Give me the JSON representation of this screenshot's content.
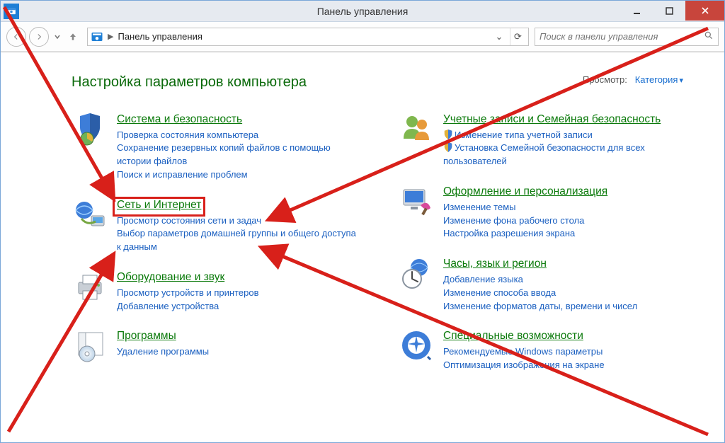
{
  "window": {
    "title": "Панель управления"
  },
  "nav": {
    "breadcrumb": "Панель управления",
    "search_placeholder": "Поиск в панели управления"
  },
  "page": {
    "heading": "Настройка параметров компьютера",
    "view_label": "Просмотр:",
    "view_value": "Категория"
  },
  "left": [
    {
      "id": "system-security",
      "icon": "shield-chart",
      "title": "Система и безопасность",
      "links": [
        "Проверка состояния компьютера",
        "Сохранение резервных копий файлов с помощью истории файлов",
        "Поиск и исправление проблем"
      ]
    },
    {
      "id": "network-internet",
      "icon": "globe-net",
      "title": "Сеть и Интернет",
      "highlight": true,
      "links": [
        "Просмотр состояния сети и задач",
        "Выбор параметров домашней группы и общего доступа к данным"
      ]
    },
    {
      "id": "hardware-sound",
      "icon": "printer",
      "title": "Оборудование и звук",
      "links": [
        "Просмотр устройств и принтеров",
        "Добавление устройства"
      ]
    },
    {
      "id": "programs",
      "icon": "disc-box",
      "title": "Программы",
      "links": [
        "Удаление программы"
      ]
    }
  ],
  "right": [
    {
      "id": "user-accounts",
      "icon": "people",
      "title": "Учетные записи и Семейная безопасность",
      "links": [
        {
          "text": "Изменение типа учетной записи",
          "shield": true
        },
        {
          "text": "Установка Семейной безопасности для всех пользователей",
          "shield": true
        }
      ]
    },
    {
      "id": "appearance",
      "icon": "monitor-paint",
      "title": "Оформление и персонализация",
      "links": [
        "Изменение темы",
        "Изменение фона рабочего стола",
        "Настройка разрешения экрана"
      ]
    },
    {
      "id": "clock-region",
      "icon": "clock-globe",
      "title": "Часы, язык и регион",
      "links": [
        "Добавление языка",
        "Изменение способа ввода",
        "Изменение форматов даты, времени и чисел"
      ]
    },
    {
      "id": "accessibility",
      "icon": "ease-access",
      "title": "Специальные возможности",
      "links": [
        "Рекомендуемые Windows параметры",
        "Оптимизация изображения на экране"
      ]
    }
  ]
}
